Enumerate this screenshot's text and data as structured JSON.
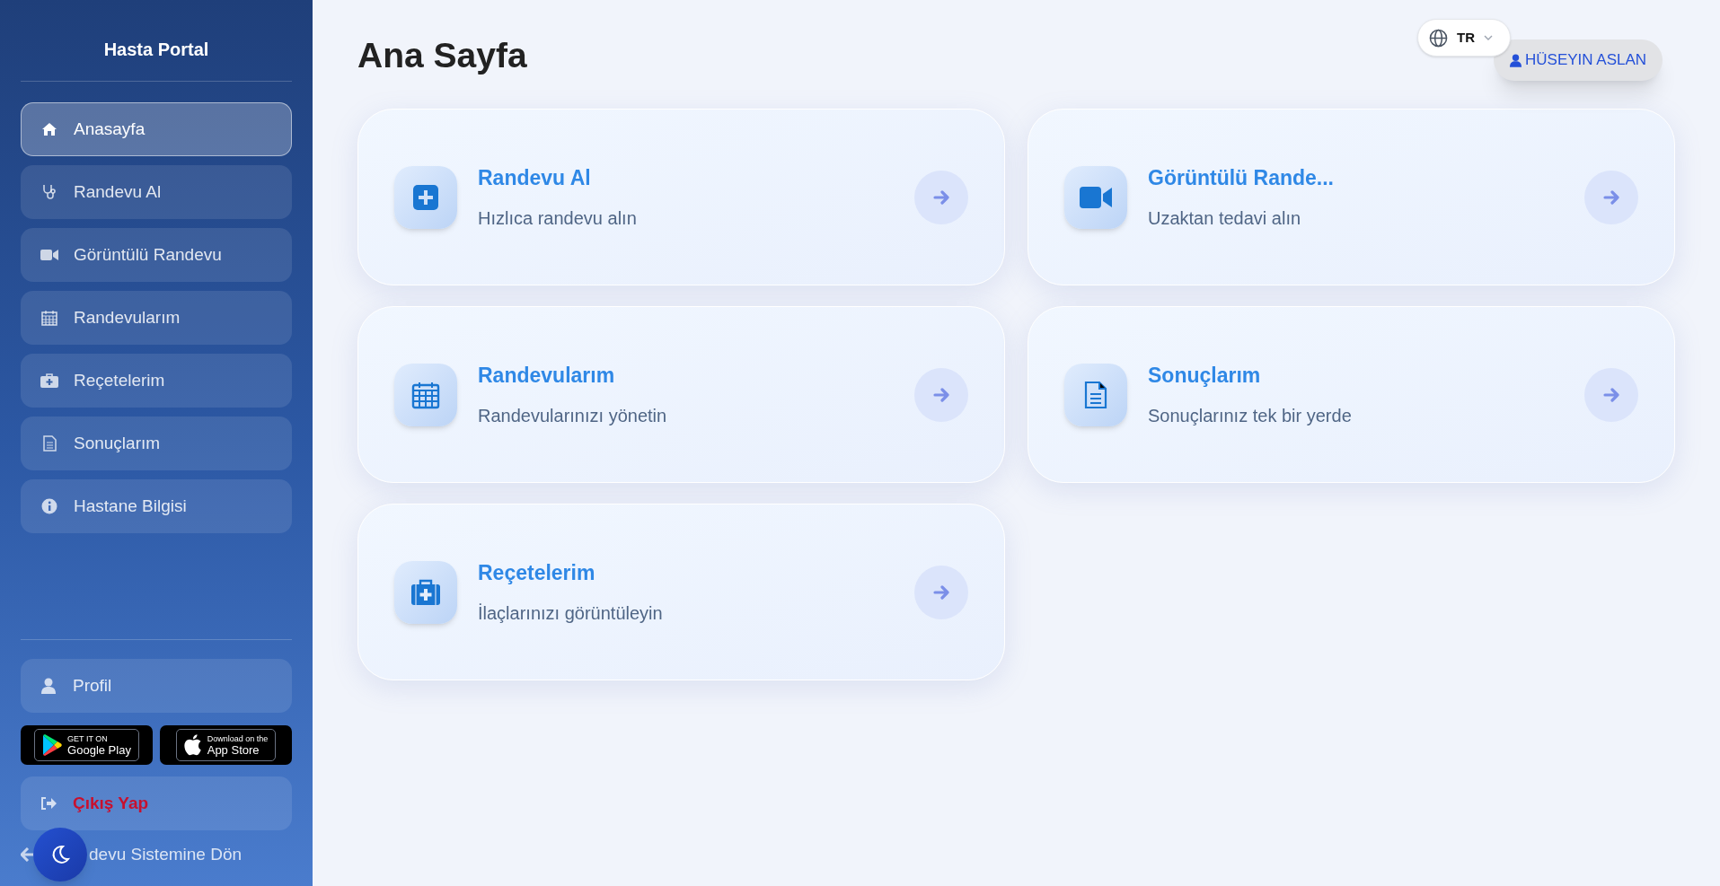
{
  "sidebar": {
    "title": "Hasta Portal",
    "items": [
      {
        "label": "Anasayfa",
        "selected": true
      },
      {
        "label": "Randevu Al",
        "selected": false
      },
      {
        "label": "Görüntülü Randevu",
        "selected": false
      },
      {
        "label": "Randevularım",
        "selected": false
      },
      {
        "label": "Reçetelerim",
        "selected": false
      },
      {
        "label": "Sonuçlarım",
        "selected": false
      },
      {
        "label": "Hastane Bilgisi",
        "selected": false
      }
    ],
    "profile": {
      "label": "Profil",
      "kind": "normal"
    },
    "store_badges": [
      {
        "small": "GET IT ON",
        "big": "Google Play"
      },
      {
        "small": "Download on the",
        "big": "App Store"
      }
    ],
    "logout": {
      "label": "Çıkış Yap",
      "kind": "danger"
    },
    "back_link": "devu Sistemine Dön"
  },
  "header": {
    "title": "Ana Sayfa",
    "user": "HÜSEYIN ASLAN",
    "language": "TR"
  },
  "cards": [
    {
      "title": "Randevu Al",
      "subtitle": "Hızlıca randevu alın"
    },
    {
      "title": "Görüntülü Rande...",
      "subtitle": "Uzaktan tedavi alın"
    },
    {
      "title": "Randevularım",
      "subtitle": "Randevularınızı yönetin"
    },
    {
      "title": "Sonuçlarım",
      "subtitle": "Sonuçlarınız tek bir yerde"
    },
    {
      "title": "Reçetelerim",
      "subtitle": "İlaçlarınızı görüntüleyin"
    }
  ]
}
